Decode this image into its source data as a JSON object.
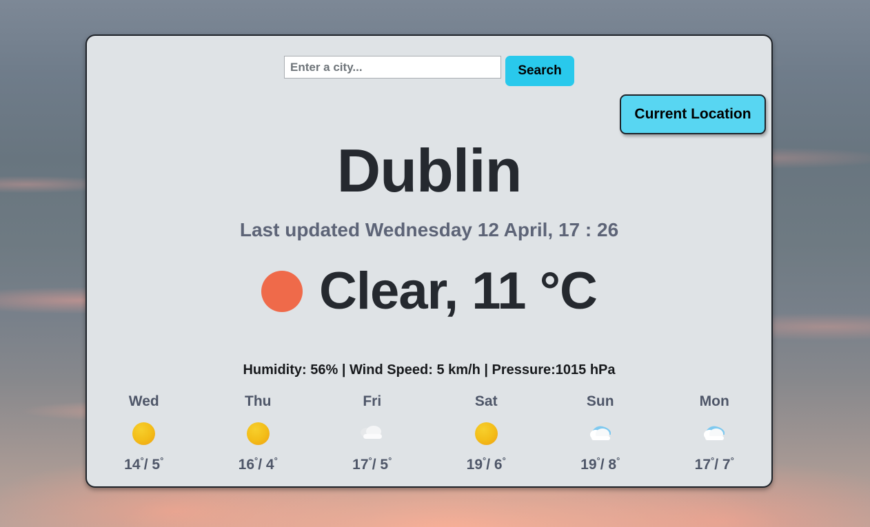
{
  "background": {
    "description": "dusk sky with salmon clouds",
    "sky_color": "#6b7785",
    "cloud_color": "#f0a892"
  },
  "card": {
    "background_color": "#dfe3e6",
    "border_color": "#1e2228"
  },
  "search": {
    "placeholder": "Enter a city...",
    "value": "",
    "button_label": "Search",
    "button_color": "#29c9ec"
  },
  "current_location": {
    "label": "Current Location",
    "color": "#58d6f2"
  },
  "current": {
    "city": "Dublin",
    "last_updated": "Last updated Wednesday 12 April, 17 : 26",
    "condition_text": "Clear, 11 °C",
    "condition": "Clear",
    "temperature_c": 11,
    "icon": "sun-icon",
    "icon_color": "#ef6a4a",
    "stats_text": "Humidity: 56% | Wind Speed: 5 km/h | Pressure:1015 hPa",
    "humidity_pct": 56,
    "wind_speed_kmh": 5,
    "pressure_hpa": 1015
  },
  "forecast": [
    {
      "day": "Wed",
      "icon": "sun-icon",
      "high": "14",
      "low": "5",
      "temp_text": "14° / 5°"
    },
    {
      "day": "Thu",
      "icon": "sun-icon",
      "high": "16",
      "low": "4",
      "temp_text": "16° / 4°"
    },
    {
      "day": "Fri",
      "icon": "cloud-icon",
      "high": "17",
      "low": "5",
      "temp_text": "17° / 5°"
    },
    {
      "day": "Sat",
      "icon": "sun-icon",
      "high": "19",
      "low": "6",
      "temp_text": "19° / 6°"
    },
    {
      "day": "Sun",
      "icon": "partly-cloudy-icon",
      "high": "19",
      "low": "8",
      "temp_text": "19° / 8°"
    },
    {
      "day": "Mon",
      "icon": "partly-cloudy-icon",
      "high": "17",
      "low": "7",
      "temp_text": "17° / 7°"
    }
  ]
}
